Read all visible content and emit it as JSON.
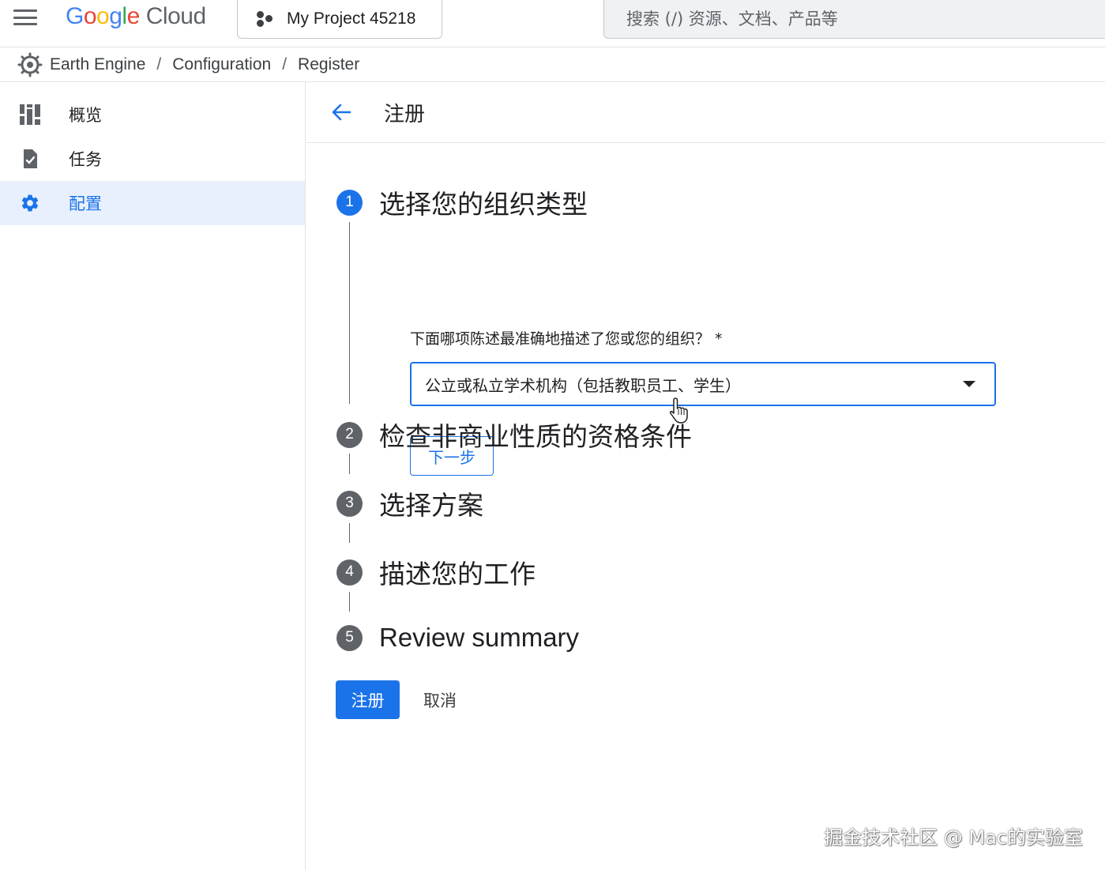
{
  "header": {
    "menu_icon": "menu-icon",
    "logo": {
      "letters": [
        "G",
        "o",
        "o",
        "g",
        "l",
        "e"
      ],
      "product": "Cloud"
    },
    "project_label": "My Project 45218",
    "search_placeholder": "搜索 (/) 资源、文档、产品等"
  },
  "breadcrumb": {
    "icon": "earth-engine-icon",
    "items": [
      "Earth Engine",
      "Configuration",
      "Register"
    ],
    "separator": "/"
  },
  "sidebar": {
    "items": [
      {
        "label": "概览",
        "icon": "dashboard-icon",
        "active": false
      },
      {
        "label": "任务",
        "icon": "task-icon",
        "active": false
      },
      {
        "label": "配置",
        "icon": "gear-icon",
        "active": true
      }
    ]
  },
  "page": {
    "title": "注册",
    "back_icon": "arrow-back-icon"
  },
  "steps": [
    {
      "num": "1",
      "title": "选择您的组织类型",
      "active": true
    },
    {
      "num": "2",
      "title": "检查非商业性质的资格条件",
      "active": false
    },
    {
      "num": "3",
      "title": "选择方案",
      "active": false
    },
    {
      "num": "4",
      "title": "描述您的工作",
      "active": false
    },
    {
      "num": "5",
      "title": "Review summary",
      "active": false
    }
  ],
  "step1": {
    "question": "下面哪项陈述最准确地描述了您或您的组织？ *",
    "selected_value": "公立或私立学术机构（包括教职员工、学生）",
    "next_label": "下一步"
  },
  "actions": {
    "register_label": "注册",
    "cancel_label": "取消"
  },
  "watermark": "掘金技术社区 @ Mac的实验室",
  "colors": {
    "accent": "#1a73e8",
    "active_nav_bg": "#e8f0fe",
    "step_inactive": "#5f6368"
  }
}
